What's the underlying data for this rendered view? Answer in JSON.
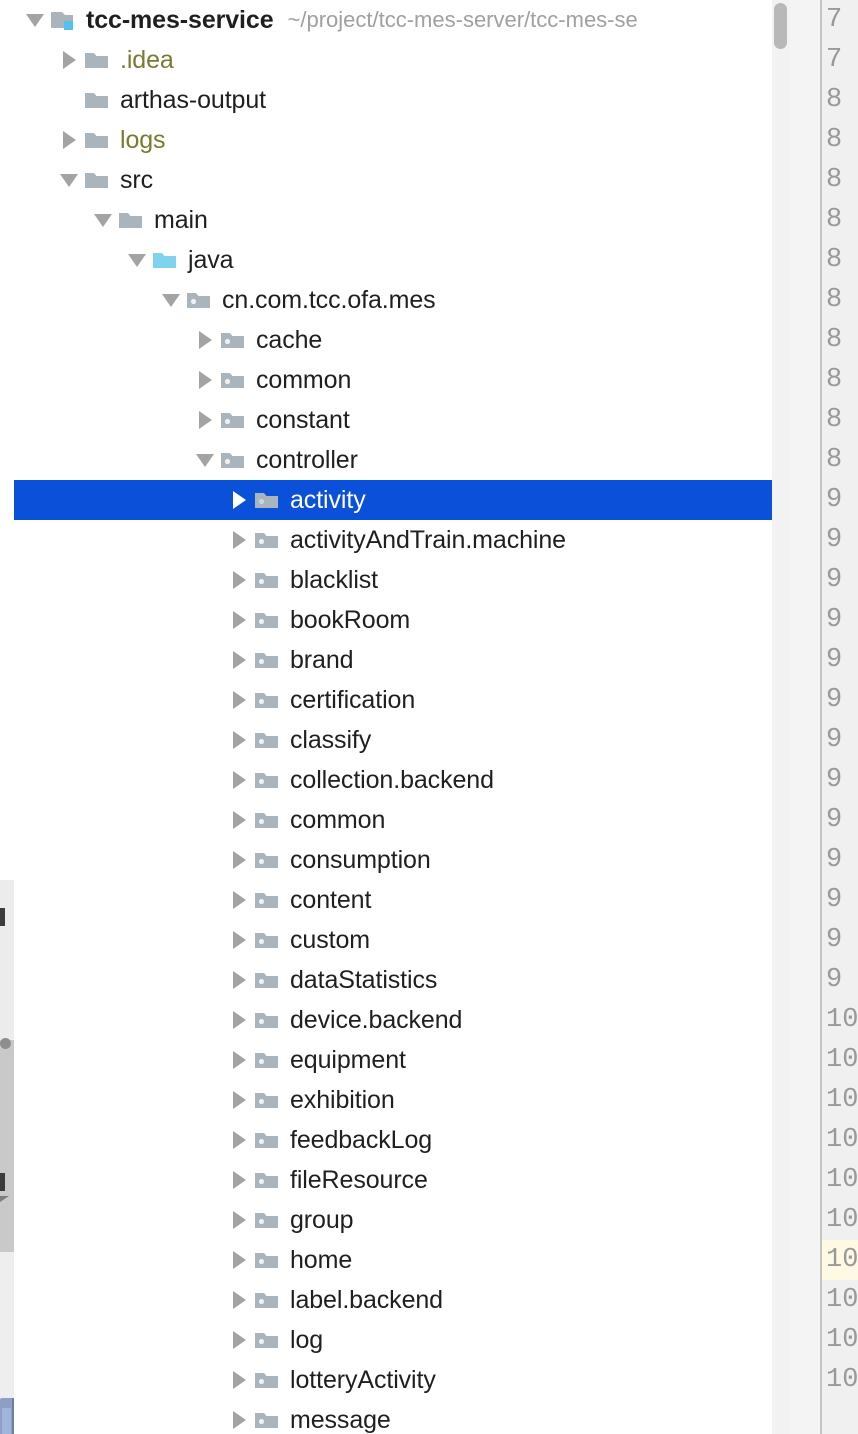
{
  "window": {
    "type": "ide-project-tool-window",
    "selection_color": "#0a50d8",
    "selection_text_color": "#ffffff",
    "excluded_folder_color": "#7a7a33",
    "current_line_highlight_color": "#fdf9e2"
  },
  "project_tree": {
    "root": {
      "label": "tcc-mes-service",
      "path": "~/project/tcc-mes-server/tcc-mes-se",
      "icon": "module-icon",
      "state": "expanded",
      "depth": 0,
      "bold": true
    },
    "items": [
      {
        "label": ".idea",
        "icon": "folder-icon",
        "state": "collapsed",
        "depth": 1,
        "excluded": true
      },
      {
        "label": "arthas-output",
        "icon": "folder-icon",
        "state": "leaf",
        "depth": 1
      },
      {
        "label": "logs",
        "icon": "folder-icon",
        "state": "collapsed",
        "depth": 1,
        "excluded": true
      },
      {
        "label": "src",
        "icon": "folder-icon",
        "state": "expanded",
        "depth": 1
      },
      {
        "label": "main",
        "icon": "folder-icon",
        "state": "expanded",
        "depth": 2
      },
      {
        "label": "java",
        "icon": "source-root-icon",
        "state": "expanded",
        "depth": 3
      },
      {
        "label": "cn.com.tcc.ofa.mes",
        "icon": "package-icon",
        "state": "expanded",
        "depth": 4
      },
      {
        "label": "cache",
        "icon": "package-icon",
        "state": "collapsed",
        "depth": 5
      },
      {
        "label": "common",
        "icon": "package-icon",
        "state": "collapsed",
        "depth": 5
      },
      {
        "label": "constant",
        "icon": "package-icon",
        "state": "collapsed",
        "depth": 5
      },
      {
        "label": "controller",
        "icon": "package-icon",
        "state": "expanded",
        "depth": 5
      },
      {
        "label": "activity",
        "icon": "package-icon",
        "state": "collapsed",
        "depth": 6,
        "selected": true
      },
      {
        "label": "activityAndTrain.machine",
        "icon": "package-icon",
        "state": "collapsed",
        "depth": 6
      },
      {
        "label": "blacklist",
        "icon": "package-icon",
        "state": "collapsed",
        "depth": 6
      },
      {
        "label": "bookRoom",
        "icon": "package-icon",
        "state": "collapsed",
        "depth": 6
      },
      {
        "label": "brand",
        "icon": "package-icon",
        "state": "collapsed",
        "depth": 6
      },
      {
        "label": "certification",
        "icon": "package-icon",
        "state": "collapsed",
        "depth": 6
      },
      {
        "label": "classify",
        "icon": "package-icon",
        "state": "collapsed",
        "depth": 6
      },
      {
        "label": "collection.backend",
        "icon": "package-icon",
        "state": "collapsed",
        "depth": 6
      },
      {
        "label": "common",
        "icon": "package-icon",
        "state": "collapsed",
        "depth": 6
      },
      {
        "label": "consumption",
        "icon": "package-icon",
        "state": "collapsed",
        "depth": 6
      },
      {
        "label": "content",
        "icon": "package-icon",
        "state": "collapsed",
        "depth": 6
      },
      {
        "label": "custom",
        "icon": "package-icon",
        "state": "collapsed",
        "depth": 6
      },
      {
        "label": "dataStatistics",
        "icon": "package-icon",
        "state": "collapsed",
        "depth": 6
      },
      {
        "label": "device.backend",
        "icon": "package-icon",
        "state": "collapsed",
        "depth": 6
      },
      {
        "label": "equipment",
        "icon": "package-icon",
        "state": "collapsed",
        "depth": 6
      },
      {
        "label": "exhibition",
        "icon": "package-icon",
        "state": "collapsed",
        "depth": 6
      },
      {
        "label": "feedbackLog",
        "icon": "package-icon",
        "state": "collapsed",
        "depth": 6
      },
      {
        "label": "fileResource",
        "icon": "package-icon",
        "state": "collapsed",
        "depth": 6
      },
      {
        "label": "group",
        "icon": "package-icon",
        "state": "collapsed",
        "depth": 6
      },
      {
        "label": "home",
        "icon": "package-icon",
        "state": "collapsed",
        "depth": 6
      },
      {
        "label": "label.backend",
        "icon": "package-icon",
        "state": "collapsed",
        "depth": 6
      },
      {
        "label": "log",
        "icon": "package-icon",
        "state": "collapsed",
        "depth": 6
      },
      {
        "label": "lotteryActivity",
        "icon": "package-icon",
        "state": "collapsed",
        "depth": 6
      },
      {
        "label": "message",
        "icon": "package-icon",
        "state": "collapsed",
        "depth": 6
      }
    ]
  },
  "editor_gutter": {
    "line_numbers": [
      {
        "text": "7",
        "current": false
      },
      {
        "text": "7",
        "current": false
      },
      {
        "text": "8",
        "current": false
      },
      {
        "text": "8",
        "current": false
      },
      {
        "text": "8",
        "current": false
      },
      {
        "text": "8",
        "current": false
      },
      {
        "text": "8",
        "current": false
      },
      {
        "text": "8",
        "current": false
      },
      {
        "text": "8",
        "current": false
      },
      {
        "text": "8",
        "current": false
      },
      {
        "text": "8",
        "current": false
      },
      {
        "text": "8",
        "current": false
      },
      {
        "text": "9",
        "current": false
      },
      {
        "text": "9",
        "current": false
      },
      {
        "text": "9",
        "current": false
      },
      {
        "text": "9",
        "current": false
      },
      {
        "text": "9",
        "current": false
      },
      {
        "text": "9",
        "current": false
      },
      {
        "text": "9",
        "current": false
      },
      {
        "text": "9",
        "current": false
      },
      {
        "text": "9",
        "current": false
      },
      {
        "text": "9",
        "current": false
      },
      {
        "text": "9",
        "current": false
      },
      {
        "text": "9",
        "current": false
      },
      {
        "text": "9",
        "current": false
      },
      {
        "text": "10",
        "current": false
      },
      {
        "text": "10",
        "current": false
      },
      {
        "text": "10",
        "current": false
      },
      {
        "text": "10",
        "current": false
      },
      {
        "text": "10",
        "current": false
      },
      {
        "text": "10",
        "current": false
      },
      {
        "text": "10",
        "current": true
      },
      {
        "text": "10",
        "current": false
      },
      {
        "text": "10",
        "current": false
      },
      {
        "text": "10",
        "current": false
      }
    ]
  },
  "scrollbar": {
    "orientation": "vertical",
    "position": "top"
  }
}
